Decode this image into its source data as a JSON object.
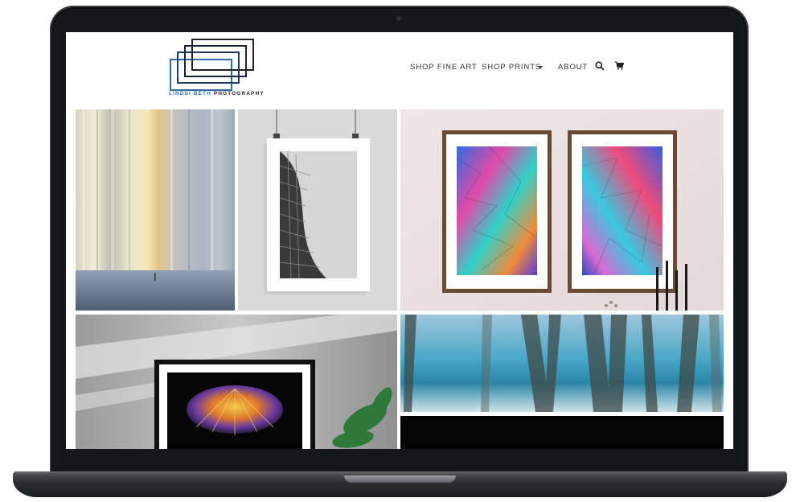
{
  "site": {
    "logo_name": "LINDSI BETH",
    "logo_tagline": "PHOTOGRAPHY",
    "brand_color": "#2d6ba9"
  },
  "nav": {
    "items": [
      {
        "label": "SHOP FINE ART"
      },
      {
        "label": "SHOP PRINTS"
      },
      {
        "label": "ABOUT"
      }
    ],
    "icons": [
      "search-icon",
      "cart-icon"
    ]
  },
  "gallery": {
    "tiles": [
      {
        "name": "sunrise-stripes-over-water-photo"
      },
      {
        "name": "curved-building-facade-framed-print"
      },
      {
        "name": "colorful-abstract-diptych-framed-prints"
      },
      {
        "name": "carnival-swing-ride-framed-print"
      },
      {
        "name": "blue-water-through-grasses-photo"
      },
      {
        "name": "dark-tile-photo"
      }
    ]
  }
}
